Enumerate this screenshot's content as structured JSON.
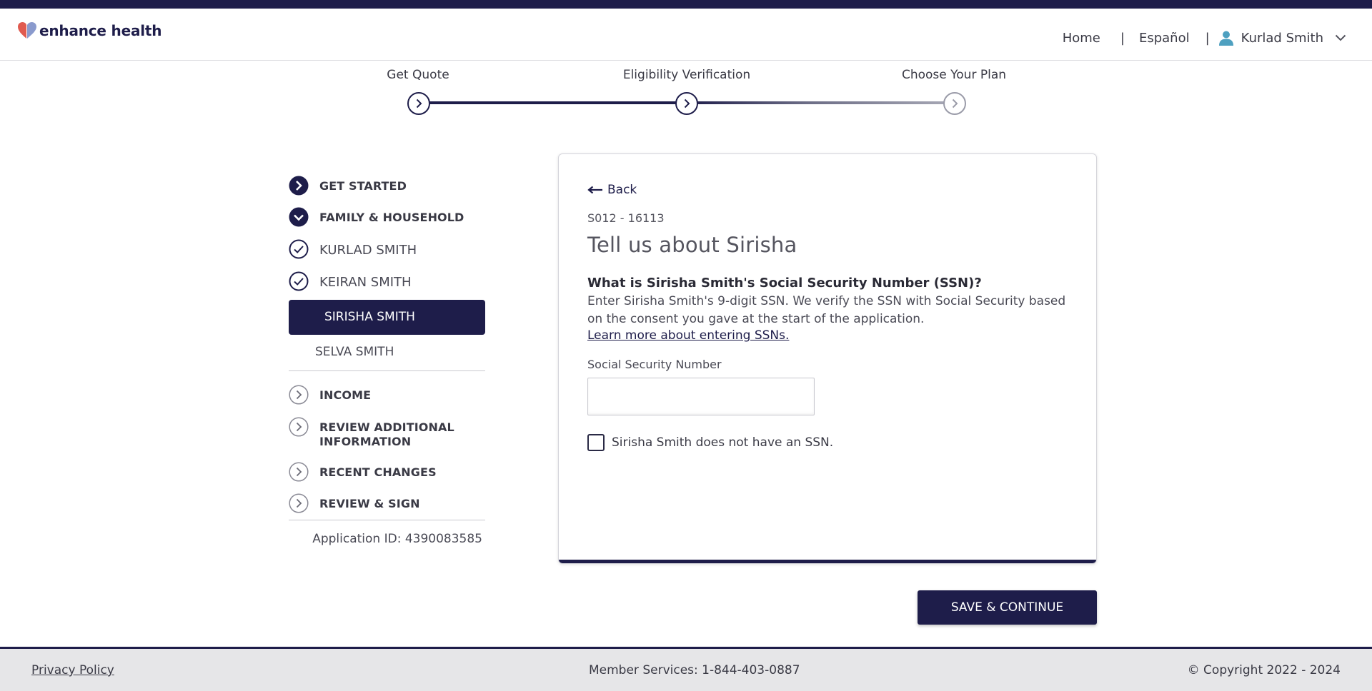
{
  "header": {
    "logo_text": "enhance health",
    "nav": {
      "home": "Home",
      "language": "Español",
      "user_name": "Kurlad Smith",
      "separator": "|"
    }
  },
  "progress": {
    "steps": [
      {
        "label": "Get Quote",
        "status": "complete"
      },
      {
        "label": "Eligibility Verification",
        "status": "current"
      },
      {
        "label": "Choose Your Plan",
        "status": "upcoming"
      }
    ]
  },
  "sidebar": {
    "sections": [
      {
        "label": "GET STARTED",
        "icon": "chevron-right-filled-icon"
      },
      {
        "label": "FAMILY & HOUSEHOLD",
        "icon": "chevron-down-filled-icon"
      },
      {
        "label": "KURLAD SMITH",
        "icon": "check-circle-icon"
      },
      {
        "label": "KEIRAN SMITH",
        "icon": "check-circle-icon"
      },
      {
        "label": "SIRISHA SMITH",
        "active": true
      },
      {
        "label": "SELVA SMITH"
      },
      {
        "label": "INCOME",
        "icon": "chevron-right-outline-icon"
      },
      {
        "label": "REVIEW ADDITIONAL INFORMATION",
        "icon": "chevron-right-outline-icon"
      },
      {
        "label": "RECENT CHANGES",
        "icon": "chevron-right-outline-icon"
      },
      {
        "label": "REVIEW & SIGN",
        "icon": "chevron-right-outline-icon"
      }
    ],
    "application_id": "Application ID: 4390083585"
  },
  "form": {
    "back_label": "Back",
    "code": "S012 - 16113",
    "title": "Tell us about Sirisha",
    "question": "What is Sirisha Smith's Social Security Number (SSN)?",
    "description": "Enter Sirisha Smith's 9-digit SSN. We verify the SSN with Social Security based on the consent you gave at the start of the application.",
    "learn_more": "Learn more about entering SSNs.",
    "ssn_label": "Social Security Number",
    "ssn_value": "",
    "no_ssn_label": "Sirisha Smith does not have an SSN.",
    "no_ssn_checked": false
  },
  "actions": {
    "save_continue": "SAVE & CONTINUE"
  },
  "footer": {
    "privacy": "Privacy Policy",
    "member_services": "Member Services: 1-844-403-0887",
    "copyright": "© Copyright 2022 - 2024"
  },
  "colors": {
    "brand_navy": "#1e1d4a",
    "logo_red": "#e05a4f",
    "logo_blue": "#5a86c6",
    "user_icon": "#4ea0c0"
  }
}
